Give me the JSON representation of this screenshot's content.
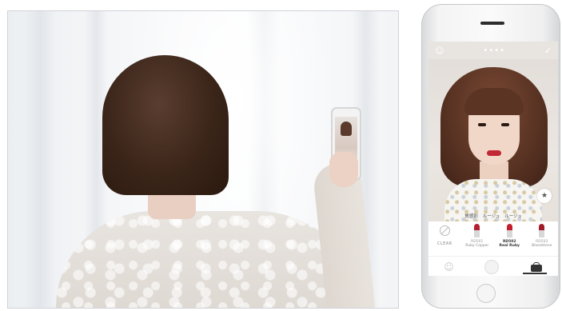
{
  "photo": {
    "subject": "person"
  },
  "app": {
    "status_bar": {
      "left_icon": "face-icon",
      "center_text": "••••",
      "right_icon": "checkmark-icon"
    },
    "breadcrumb": {
      "items": [
        "質感別",
        "ルージュ",
        "ルージュ"
      ]
    },
    "favorite_icon": "star-icon",
    "swatches": [
      {
        "label": "CLEAR",
        "code": "",
        "name": "",
        "color": ""
      },
      {
        "label": "",
        "code": "RD501",
        "name": "Ruby Copper",
        "color": "#b3202f"
      },
      {
        "label": "",
        "code": "RD502",
        "name": "Real Ruby",
        "color": "#c41e2d"
      },
      {
        "label": "",
        "code": "RD503",
        "name": "Bloodstone",
        "color": "#a11a27"
      }
    ],
    "selected_swatch_code": "RD502",
    "tabs": [
      "face-tab",
      "camera-tab",
      "makeup-tab"
    ]
  },
  "colors": {
    "accent": "#c41e2d",
    "tab_active": "#333333"
  }
}
